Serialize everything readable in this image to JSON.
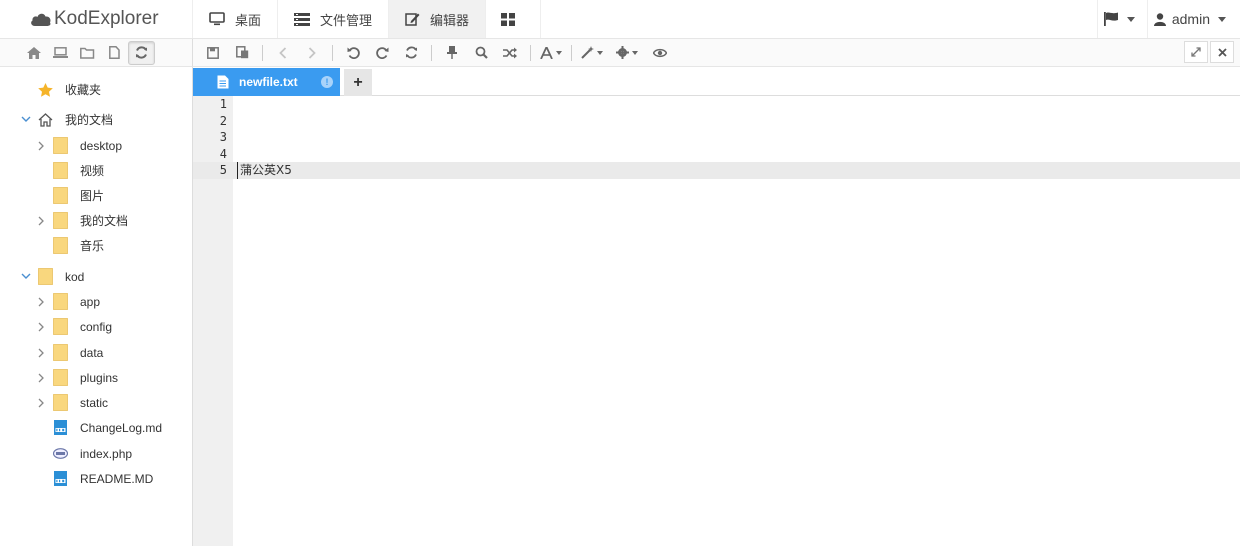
{
  "app": {
    "title": "KodExplorer"
  },
  "nav": {
    "tabs": [
      {
        "label": "桌面",
        "icon": "monitor-icon"
      },
      {
        "label": "文件管理",
        "icon": "list-icon"
      },
      {
        "label": "编辑器",
        "icon": "edit-icon"
      },
      {
        "label": "",
        "icon": "grid-icon"
      }
    ],
    "user": "admin"
  },
  "sidebar": {
    "tree": [
      {
        "label": "收藏夹",
        "icon": "star-icon",
        "expand": "none",
        "level": 0
      },
      {
        "label": "我的文档",
        "icon": "home-icon",
        "expand": "open",
        "level": 0
      },
      {
        "label": "desktop",
        "icon": "folder-icon",
        "expand": "closed",
        "level": 1
      },
      {
        "label": "视频",
        "icon": "folder-icon",
        "expand": "none",
        "level": 1
      },
      {
        "label": "图片",
        "icon": "folder-icon",
        "expand": "none",
        "level": 1
      },
      {
        "label": "我的文档",
        "icon": "folder-icon",
        "expand": "closed",
        "level": 1
      },
      {
        "label": "音乐",
        "icon": "folder-icon",
        "expand": "none",
        "level": 1
      },
      {
        "label": "kod",
        "icon": "folder-icon",
        "expand": "open",
        "level": 0
      },
      {
        "label": "app",
        "icon": "folder-icon",
        "expand": "closed",
        "level": 1
      },
      {
        "label": "config",
        "icon": "folder-icon",
        "expand": "closed",
        "level": 1
      },
      {
        "label": "data",
        "icon": "folder-icon",
        "expand": "closed",
        "level": 1
      },
      {
        "label": "plugins",
        "icon": "folder-icon",
        "expand": "closed",
        "level": 1
      },
      {
        "label": "static",
        "icon": "folder-icon",
        "expand": "closed",
        "level": 1
      },
      {
        "label": "ChangeLog.md",
        "icon": "md-file-icon",
        "expand": "none",
        "level": 1
      },
      {
        "label": "index.php",
        "icon": "php-file-icon",
        "expand": "none",
        "level": 1
      },
      {
        "label": "README.MD",
        "icon": "md-file-icon",
        "expand": "none",
        "level": 1
      }
    ]
  },
  "editor": {
    "tab_label": "newfile.txt",
    "tab_badge": "!",
    "add_tab": "+",
    "line_numbers": [
      "1",
      "2",
      "3",
      "4",
      "5"
    ],
    "line5_text": "蒲公英X5"
  },
  "colors": {
    "accent": "#3a9bf0",
    "folder": "#f9d77e",
    "gutter": "#f0f0f0"
  }
}
